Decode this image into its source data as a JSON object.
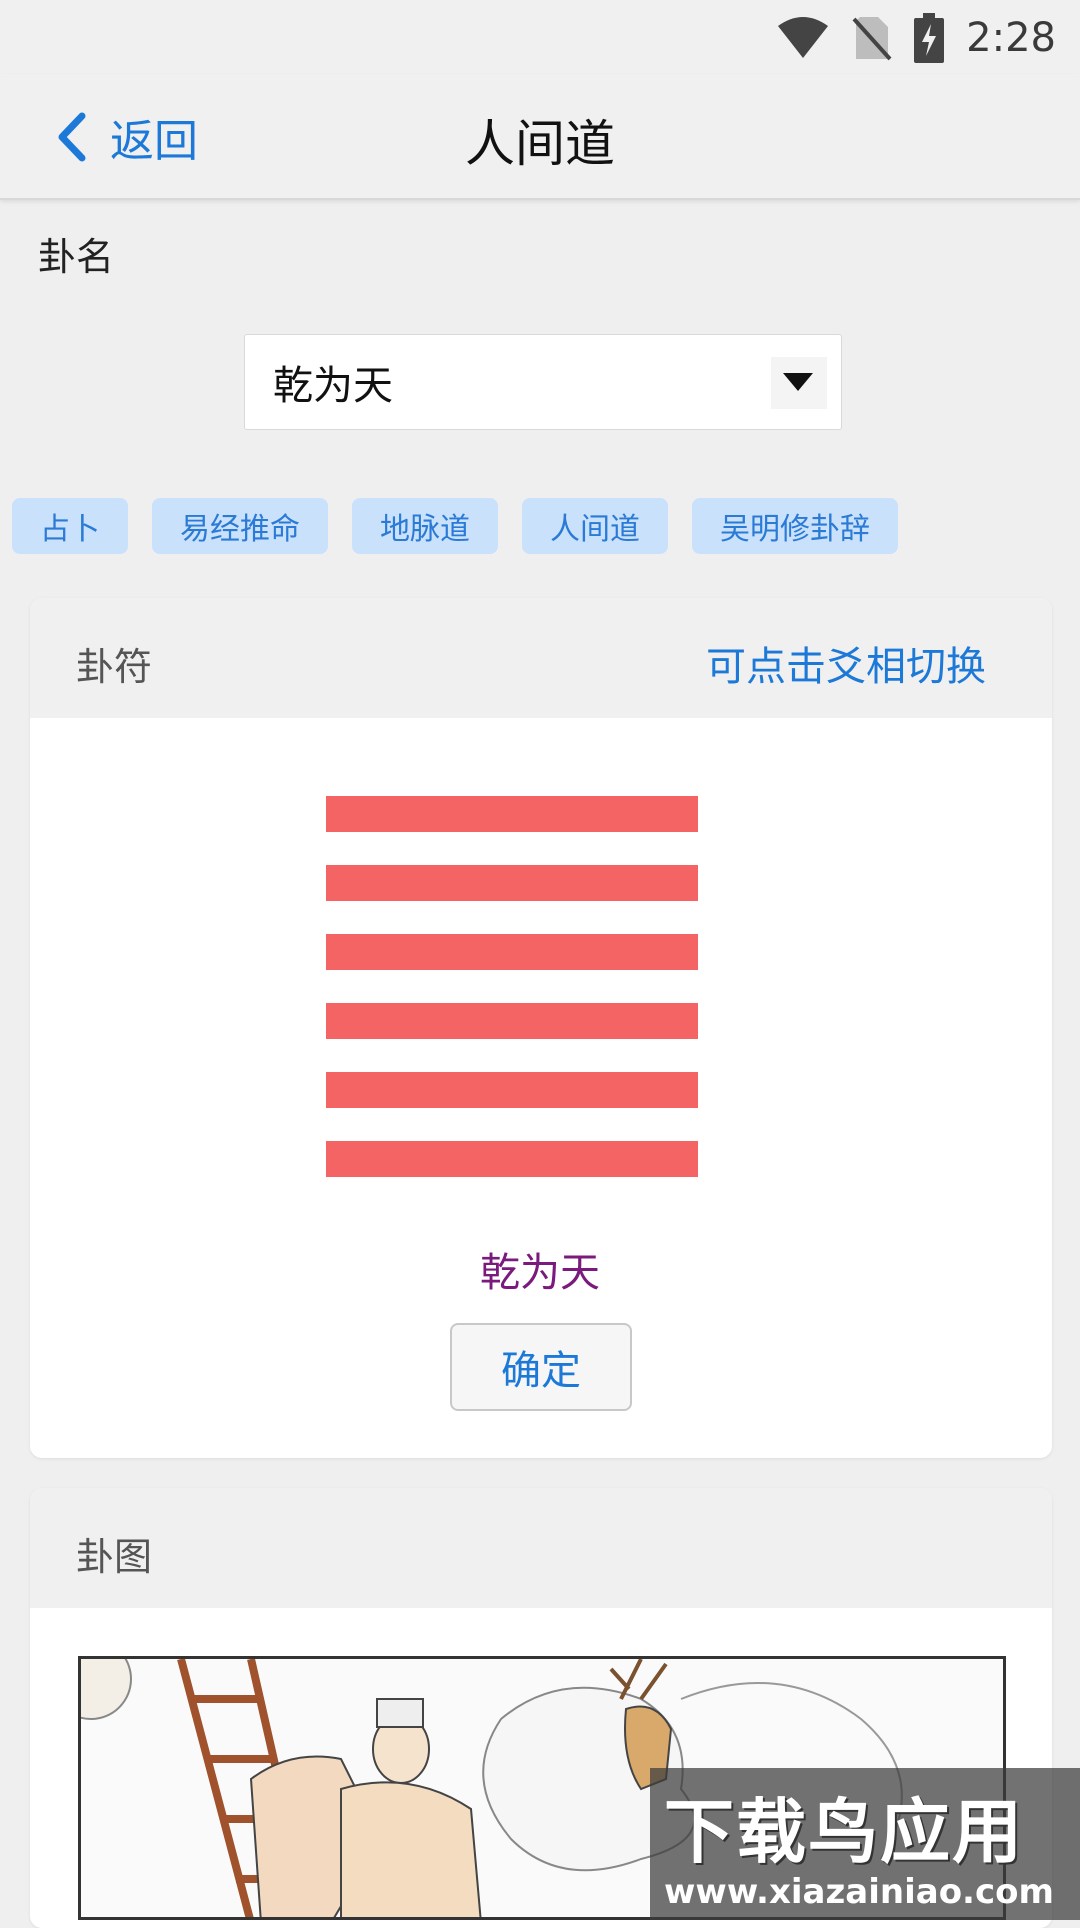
{
  "status_bar": {
    "time": "2:28",
    "icons": [
      "wifi-icon",
      "no-sim-icon",
      "battery-charging-icon"
    ]
  },
  "nav": {
    "back_label": "返回",
    "title": "人间道"
  },
  "gua_name_label": "卦名",
  "select": {
    "value": "乾为天"
  },
  "tags": [
    {
      "label": "占卜"
    },
    {
      "label": "易经推命"
    },
    {
      "label": "地脉道"
    },
    {
      "label": "人间道"
    },
    {
      "label": "吴明修卦辞"
    }
  ],
  "symbol_card": {
    "title": "卦符",
    "action": "可点击爻相切换",
    "lines": [
      "yang",
      "yang",
      "yang",
      "yang",
      "yang",
      "yang"
    ],
    "line_color": "#f46464",
    "name": "乾为天",
    "confirm_label": "确定"
  },
  "image_card": {
    "title": "卦图"
  },
  "watermark": {
    "line1": "下载鸟应用",
    "line2": "www.xiazainiao.com"
  },
  "colors": {
    "accent": "#1d79d8",
    "tag_bg": "#c9e1fb",
    "hex_name": "#7a1a7c"
  }
}
